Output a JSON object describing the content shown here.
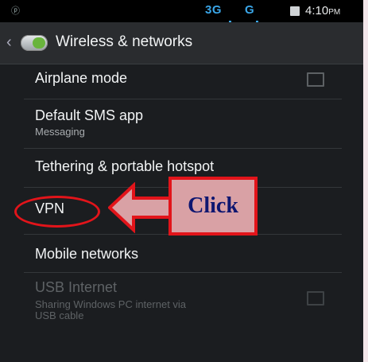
{
  "status_bar": {
    "left_icon": "ⓟ",
    "network": "3G",
    "network2": "G",
    "time": "4:10",
    "ampm": "PM"
  },
  "header": {
    "title": "Wireless & networks",
    "back_icon": "chevron-left-icon",
    "app_icon": "settings-toggle-icon"
  },
  "settings": [
    {
      "label": "Airplane mode",
      "has_checkbox": true,
      "checked": false
    },
    {
      "label": "Default SMS app",
      "subtitle": "Messaging"
    },
    {
      "label": "Tethering & portable hotspot"
    },
    {
      "label": "VPN"
    },
    {
      "label": "Mobile networks"
    },
    {
      "label": "USB Internet",
      "subtitle_line1": "Sharing Windows PC internet via",
      "subtitle_line2": "USB cable",
      "has_checkbox": true,
      "checked": false,
      "disabled": true
    }
  ],
  "annotation": {
    "click_label": "Click",
    "accent_color": "#e2141a",
    "box_color": "#d9a1a5",
    "text_color": "#0e1670"
  }
}
